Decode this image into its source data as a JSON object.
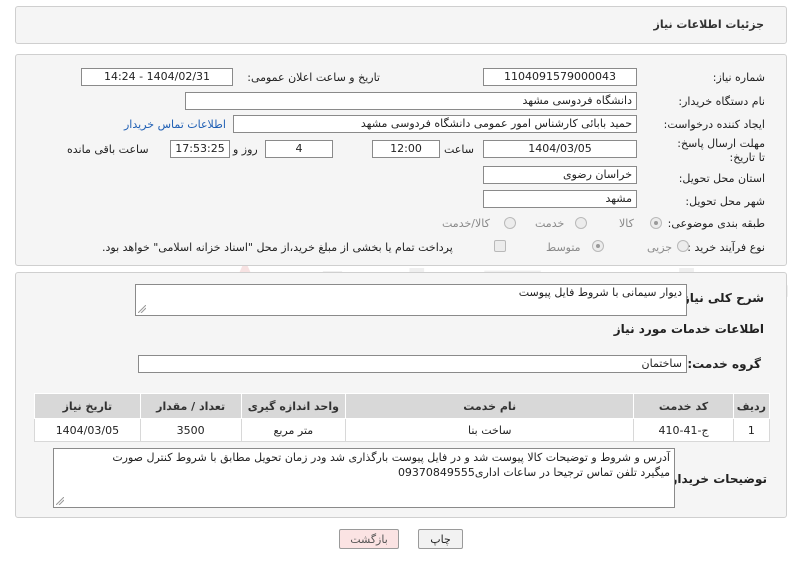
{
  "header": {
    "title": "جزئیات اطلاعات نیاز"
  },
  "watermark": {
    "text": "AriaTender.neT"
  },
  "fields": {
    "need_number_label": "شماره نیاز:",
    "need_number": "1104091579000043",
    "announce_label": "تاریخ و ساعت اعلان عمومی:",
    "announce_value": "1404/02/31 - 14:24",
    "buyer_org_label": "نام دستگاه خریدار:",
    "buyer_org": "دانشگاه فردوسی مشهد",
    "creator_label": "ایجاد کننده درخواست:",
    "creator": "حمید بابائی کارشناس امور عمومی دانشگاه فردوسی مشهد",
    "contact_link": "اطلاعات تماس خریدار",
    "deadline_label": "مهلت ارسال پاسخ: تا تاریخ:",
    "deadline_date": "1404/03/05",
    "time_label": "ساعت",
    "deadline_time": "12:00",
    "days_value": "4",
    "days_label": "روز و",
    "remaining_value": "17:53:25",
    "remaining_label": "ساعت باقی مانده",
    "province_label": "استان محل تحویل:",
    "province": "خراسان رضوی",
    "city_label": "شهر محل تحویل:",
    "city": "مشهد",
    "category_label": "طبقه بندی موضوعی:",
    "category_options": [
      "کالا",
      "خدمت",
      "کالا/خدمت"
    ],
    "purchase_label": "نوع فرآیند خرید :",
    "purchase_options": [
      "جزیی",
      "متوسط"
    ],
    "payment_note": "پرداخت تمام یا بخشی از مبلغ خرید،از محل \"اسناد خزانه اسلامی\" خواهد بود."
  },
  "summary": {
    "label": "شرح کلی نیاز:",
    "value": "دیوار سیمانی با شروط فایل پیوست"
  },
  "services": {
    "heading": "اطلاعات خدمات مورد نیاز",
    "group_label": "گروه خدمت:",
    "group_value": "ساختمان",
    "columns": [
      "ردیف",
      "کد خدمت",
      "نام خدمت",
      "واحد اندازه گیری",
      "تعداد / مقدار",
      "تاریخ نیاز"
    ],
    "rows": [
      [
        "1",
        "ج-41-410",
        "ساخت بنا",
        "متر مربع",
        "3500",
        "1404/03/05"
      ]
    ]
  },
  "notes": {
    "label": "توضیحات خریدار:",
    "line1": "آدرس و شروط  و توضیحات کالا پیوست شد و در فایل پیوست بارگذاری شد ودر زمان تحویل مطابق با شروط کنترل صورت",
    "line2": "میگیرد تلفن تماس  ترجیحا در ساعات اداری09370849555"
  },
  "buttons": {
    "print": "چاپ",
    "back": "بازگشت"
  }
}
